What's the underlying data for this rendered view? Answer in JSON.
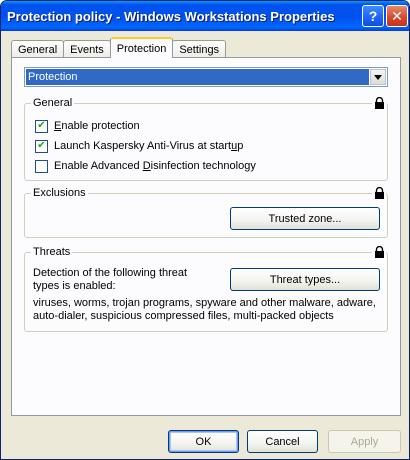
{
  "window": {
    "title": "Protection policy - Windows Workstations Properties",
    "help_label": "?",
    "close_label": "✕"
  },
  "tabs": [
    {
      "label": "General",
      "active": false
    },
    {
      "label": "Events",
      "active": false
    },
    {
      "label": "Protection",
      "active": true
    },
    {
      "label": "Settings",
      "active": false
    }
  ],
  "component_select": {
    "value": "Protection"
  },
  "general": {
    "legend": "General",
    "options": [
      {
        "prefix": "",
        "accel": "E",
        "rest": "nable protection",
        "checked": true
      },
      {
        "prefix": "Launch Kaspersky Anti-Virus at start",
        "accel": "u",
        "rest": "p",
        "checked": true
      },
      {
        "prefix": "Enable Advanced ",
        "accel": "D",
        "rest": "isinfection technology",
        "checked": false
      }
    ]
  },
  "exclusions": {
    "legend": "Exclusions",
    "trusted_zone_button": "Trusted zone..."
  },
  "threats": {
    "legend": "Threats",
    "description": "Detection of the following threat types is enabled:",
    "threat_types_button": "Threat types...",
    "enabled_list": "viruses, worms, trojan programs, spyware and other malware, adware, auto-dialer, suspicious compressed files, multi-packed objects"
  },
  "footer": {
    "ok": "OK",
    "cancel": "Cancel",
    "apply": "Apply"
  },
  "colors": {
    "title_bar": "#0054e3",
    "selection": "#316ac5",
    "checkmark": "#21a121",
    "active_tab_accent": "#ffc83c"
  }
}
